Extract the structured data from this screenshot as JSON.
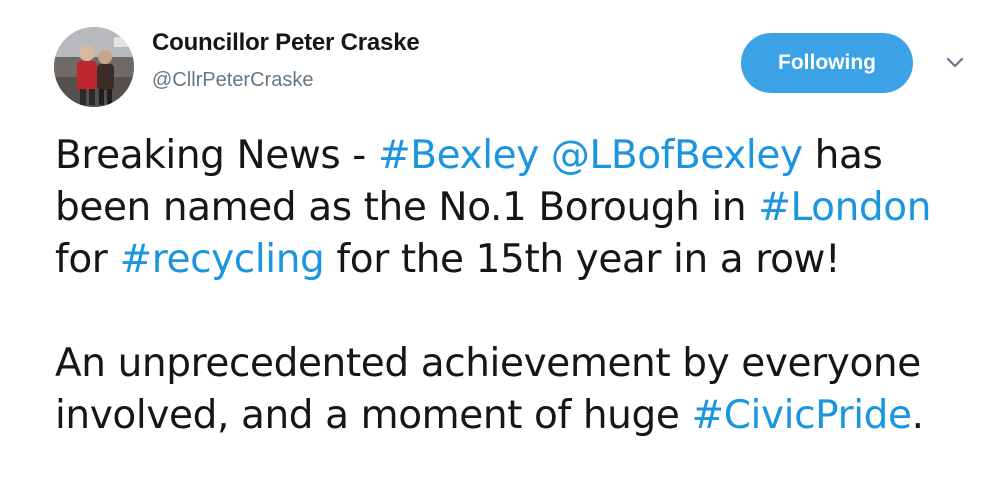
{
  "author": {
    "display_name": "Councillor Peter Craske",
    "handle": "@CllrPeterCraske"
  },
  "follow_button": {
    "label": "Following"
  },
  "icons": {
    "menu": "chevron-down-icon",
    "avatar": "profile-photo"
  },
  "colors": {
    "accent": "#1b95e0",
    "button_bg": "#3ba2e6",
    "text": "#14171a",
    "secondary_text": "#657786"
  },
  "tweet": {
    "p1": {
      "t1": "Breaking News - ",
      "hashtag_bexley": "#Bexley",
      "t2": " ",
      "mention_lbofbexley": "@LBofBexley",
      "t3": " has been named as the No.1 Borough in ",
      "hashtag_london": "#London",
      "t4": " for ",
      "hashtag_recycling": "#recycling",
      "t5": " for the 15th year in a row!"
    },
    "p2": {
      "t1": "An unprecedented achievement by everyone involved, and a moment of huge ",
      "hashtag_civicpride": "#CivicPride",
      "t2": "."
    }
  }
}
